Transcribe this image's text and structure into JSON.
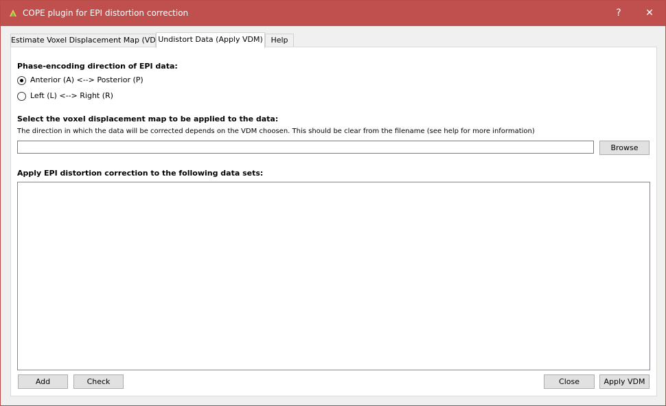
{
  "window": {
    "title": "COPE plugin for EPI distortion correction",
    "help_glyph": "?",
    "close_glyph": "✕",
    "accent_color": "#c0504d"
  },
  "tabs": [
    {
      "label": "Estimate Voxel Displacement Map (VDM)",
      "active": false
    },
    {
      "label": "Undistort Data (Apply VDM)",
      "active": true
    },
    {
      "label": "Help",
      "active": false
    }
  ],
  "phase_encoding": {
    "heading": "Phase-encoding direction of EPI data:",
    "options": [
      {
        "label": "Anterior (A) <--> Posterior (P)",
        "selected": true
      },
      {
        "label": "Left (L) <--> Right (R)",
        "selected": false
      }
    ]
  },
  "vdm": {
    "heading": "Select the voxel displacement map to be applied to the data:",
    "hint": "The direction in which the data will be corrected depends on the VDM choosen. This should be clear from the filename (see help for more information)",
    "value": "",
    "placeholder": "",
    "browse_label": "Browse"
  },
  "datasets": {
    "heading": "Apply EPI distortion correction to the following data sets:",
    "items": []
  },
  "footer": {
    "add_label": "Add",
    "check_label": "Check",
    "close_label": "Close",
    "apply_label": "Apply VDM"
  },
  "icons": {
    "app": "cope-plugin-icon",
    "help": "help-icon",
    "close": "close-icon"
  }
}
